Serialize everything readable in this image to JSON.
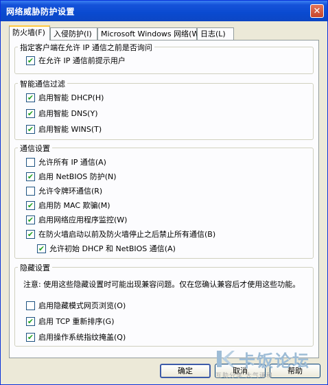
{
  "window": {
    "title": "网络威胁防护设置"
  },
  "tabs": [
    {
      "label": "防火墙(F)",
      "active": true
    },
    {
      "label": "入侵防护(I)",
      "active": false
    },
    {
      "label": "Microsoft Windows 网络(W)",
      "active": false
    },
    {
      "label": "日志(L)",
      "active": false
    }
  ],
  "groups": {
    "prompt": {
      "legend": "指定客户端在允许 IP 通信之前是否询问",
      "items": [
        {
          "label": "在允许 IP 通信前提示用户",
          "checked": true
        }
      ]
    },
    "smart_filter": {
      "legend": "智能通信过滤",
      "items": [
        {
          "label": "启用智能 DHCP(H)",
          "checked": true
        },
        {
          "label": "启用智能 DNS(Y)",
          "checked": true
        },
        {
          "label": "启用智能 WINS(T)",
          "checked": true
        }
      ]
    },
    "traffic": {
      "legend": "通信设置",
      "items": [
        {
          "label": "允许所有 IP 通信(A)",
          "checked": false
        },
        {
          "label": "启用 NetBIOS 防护(N)",
          "checked": true
        },
        {
          "label": "允许令牌环通信(R)",
          "checked": false
        },
        {
          "label": "启用防 MAC 欺骗(M)",
          "checked": true
        },
        {
          "label": "启用网络应用程序监控(W)",
          "checked": true
        },
        {
          "label": "在防火墙启动以前及防火墙停止之后禁止所有通信(B)",
          "checked": true
        },
        {
          "label": "允许初始 DHCP 和 NetBIOS 通信(A)",
          "checked": true
        }
      ]
    },
    "stealth": {
      "legend": "隐藏设置",
      "note": "注意: 使用这些隐藏设置时可能出现兼容问题。仅在您确认兼容后才使用这些功能。",
      "items": [
        {
          "label": "启用隐藏模式网页浏览(O)",
          "checked": false
        },
        {
          "label": "启用 TCP 重新排序(G)",
          "checked": true
        },
        {
          "label": "启用操作系统指纹掩盖(Q)",
          "checked": true
        }
      ]
    }
  },
  "buttons": {
    "ok": "确定",
    "cancel": "取消",
    "help": "帮助"
  },
  "watermark": {
    "brand": "卡饭论坛",
    "slogan": "互助分享  大气谦和"
  },
  "icons": {
    "close": "close-icon",
    "check": "checkmark-icon"
  },
  "colors": {
    "titlebar": "#0a4ad0",
    "check": "#21a121",
    "active_tab": "#ffc83c"
  }
}
